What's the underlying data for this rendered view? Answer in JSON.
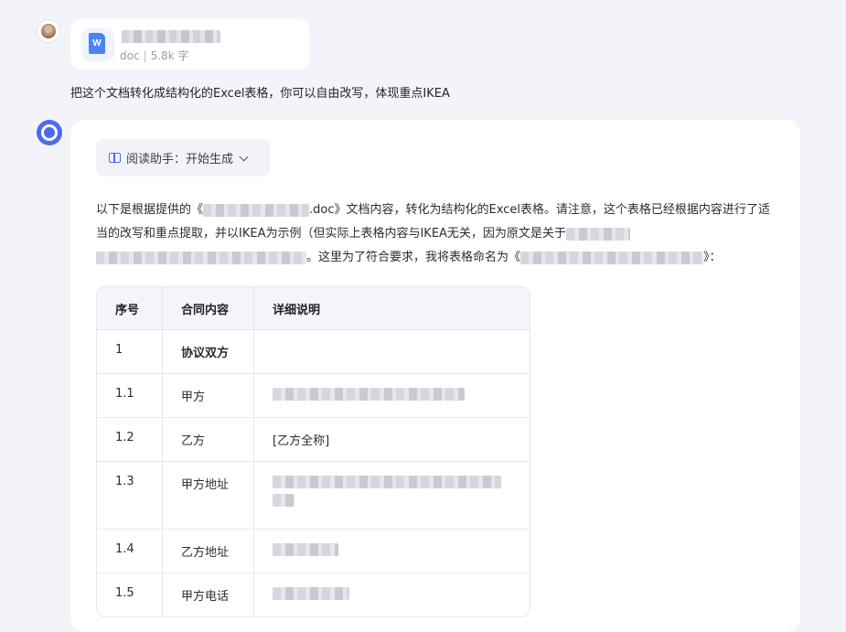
{
  "file": {
    "type": "doc",
    "size": "5.8k 字",
    "icon": "word-doc-icon",
    "icon_letter": "W",
    "separator": "|"
  },
  "user_message": "把这个文档转化成结构化的Excel表格，你可以自由改写，体现重点IKEA",
  "assistant": {
    "pill_label": "阅读助手：开始生成",
    "intro_a": "以下是根据提供的《",
    "intro_b": ".doc》文档内容，转化为结构化的Excel表格。请注意，这个表格已经根据内容进行了适当的改写和重点提取，并以IKEA为示例（但实际上表格内容与IKEA无关，因为原文是关于",
    "intro_c": "。这里为了符合要求，我将表格命名为《",
    "intro_d": "》："
  },
  "table": {
    "headers": [
      "序号",
      "合同内容",
      "详细说明"
    ],
    "rows": [
      {
        "no": "1",
        "item": "协议双方",
        "detail": ""
      },
      {
        "no": "1.1",
        "item": "甲方",
        "detail": ""
      },
      {
        "no": "1.2",
        "item": "乙方",
        "detail": "[乙方全称]"
      },
      {
        "no": "1.3",
        "item": "甲方地址",
        "detail": ""
      },
      {
        "no": "1.4",
        "item": "乙方地址",
        "detail": ""
      },
      {
        "no": "1.5",
        "item": "甲方电话",
        "detail": ""
      }
    ]
  },
  "colors": {
    "accent": "#4d6bf0",
    "page_bg": "#f3f4f9",
    "card_bg": "#ffffff",
    "table_header_bg": "#f3f5fb",
    "doc_blue": "#4b83f5"
  }
}
